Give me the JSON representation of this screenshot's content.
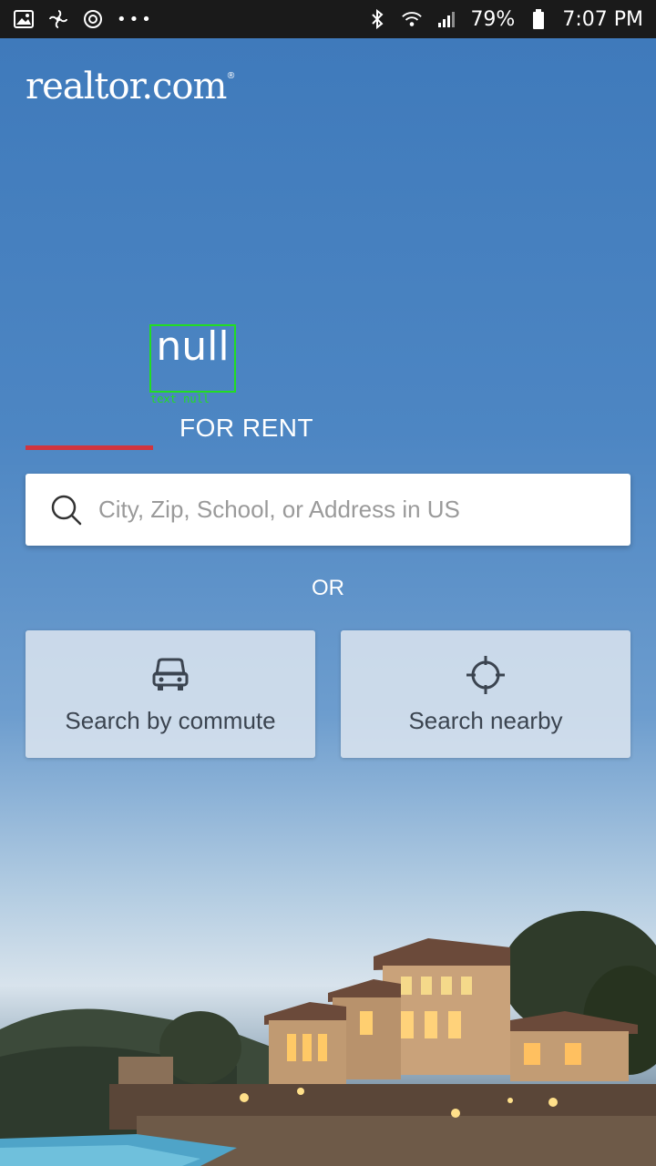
{
  "status_bar": {
    "battery": "79%",
    "time": "7:07 PM",
    "overflow": "•••"
  },
  "app": {
    "logo": "realtor.com",
    "logo_mark": "®"
  },
  "tabs": [
    {
      "label": "null",
      "debug": "text null"
    },
    {
      "label": "FOR RENT"
    }
  ],
  "search": {
    "placeholder": "City, Zip, School, or Address in US"
  },
  "divider_text": "OR",
  "actions": {
    "commute_label": "Search by commute",
    "nearby_label": "Search nearby"
  },
  "colors": {
    "accent": "#d0353f",
    "debug_box": "#22dd22"
  }
}
